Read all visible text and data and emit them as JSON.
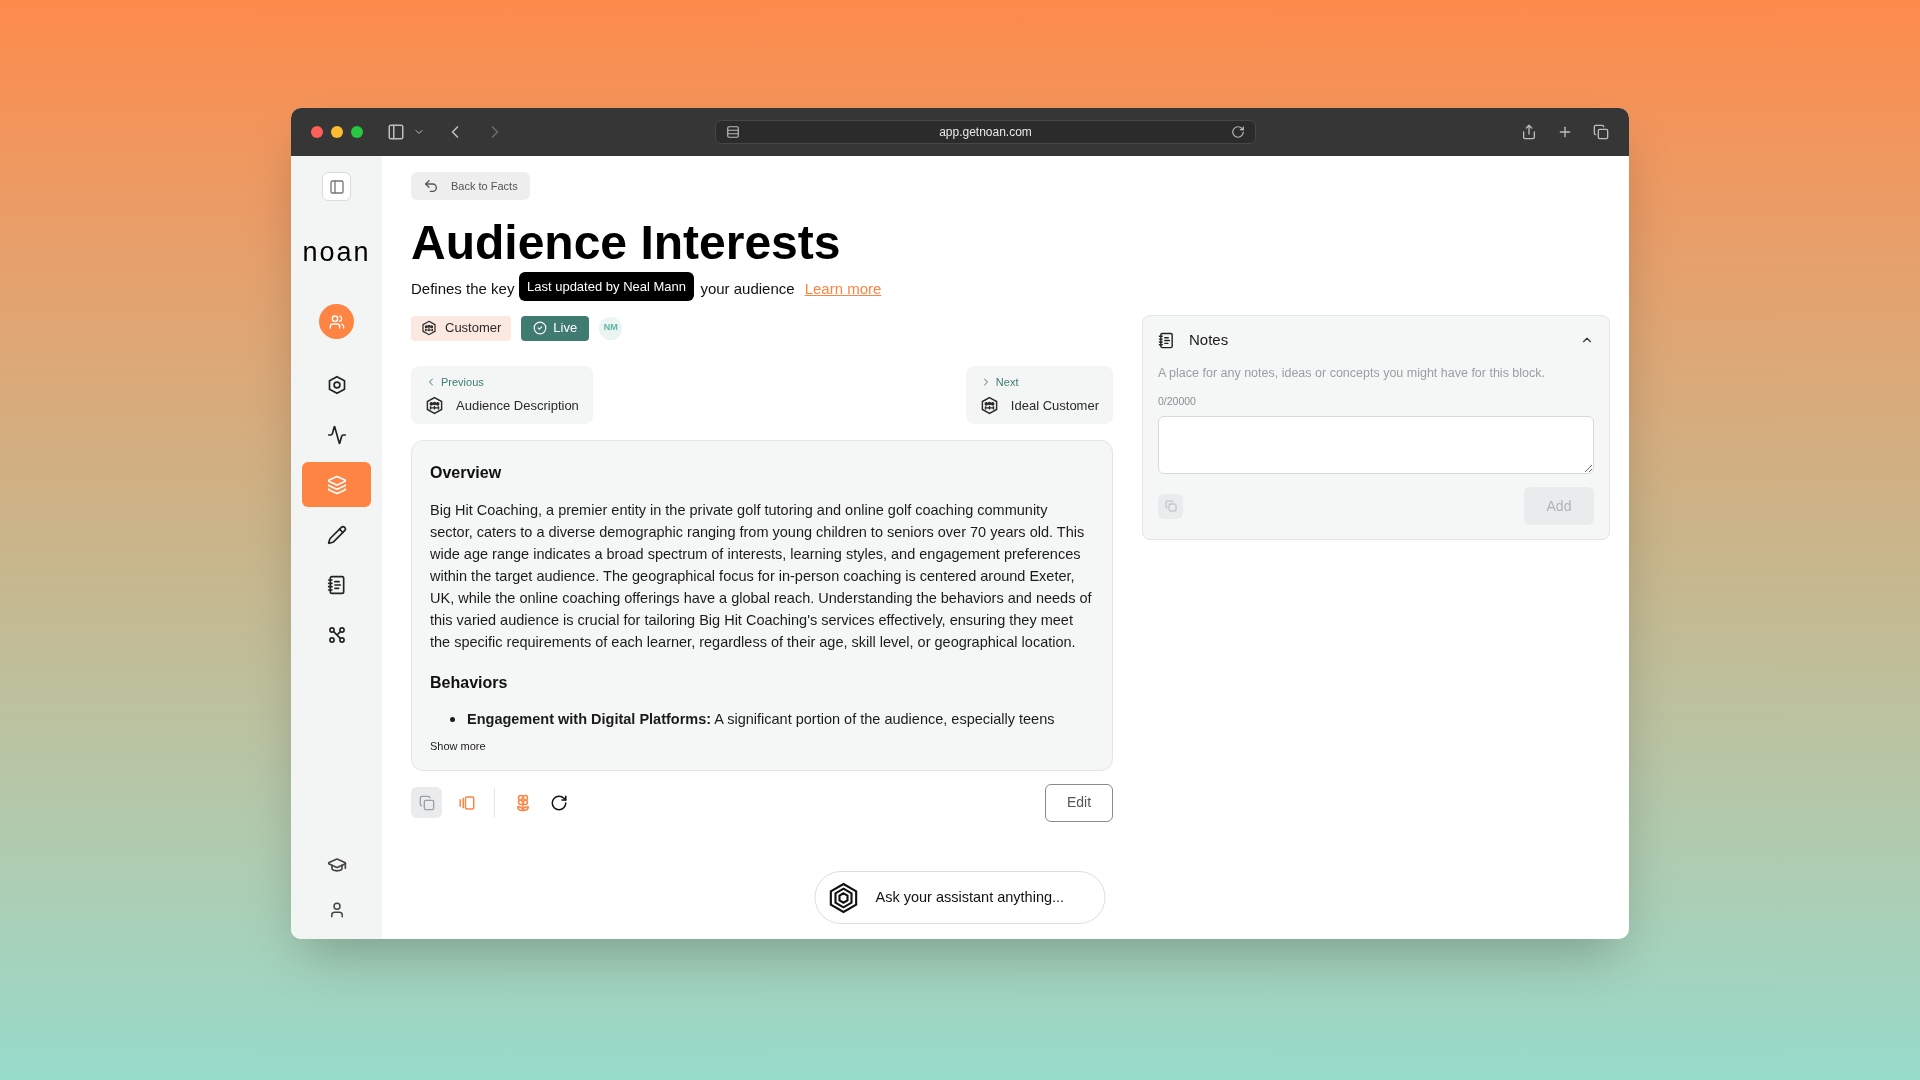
{
  "browser": {
    "url": "app.getnoan.com"
  },
  "sidebar": {
    "logo": "noan",
    "nav": [
      {
        "selected": false
      },
      {
        "selected": false
      },
      {
        "selected": true
      },
      {
        "selected": false
      },
      {
        "selected": false
      },
      {
        "selected": false
      }
    ]
  },
  "back_button": "Back to Facts",
  "title": "Audience Interests",
  "description": {
    "before": "Defines the key",
    "after": "your audience",
    "link": "Learn more"
  },
  "tooltip": "Last updated by Neal Mann",
  "tags": [
    {
      "label": "Customer",
      "kind": "category"
    },
    {
      "label": "Live",
      "kind": "status"
    }
  ],
  "avatar_initials": "NM",
  "previous": {
    "label": "Previous",
    "title": "Audience Description"
  },
  "next": {
    "label": "Next",
    "title": "Ideal Customer"
  },
  "overview": {
    "sections": [
      {
        "heading": "Overview",
        "paragraph": "Big Hit Coaching, a premier entity in the private golf tutoring and online golf coaching community sector, caters to a diverse demographic ranging from young children to seniors over 70 years old. This wide age range indicates a broad spectrum of interests, learning styles, and engagement preferences within the target audience. The geographical focus for in-person coaching is centered around Exeter, UK, while the online coaching offerings have a global reach. Understanding the behaviors and needs of this varied audience is crucial for tailoring Big Hit Coaching's services effectively, ensuring they meet the specific requirements of each learner, regardless of their age, skill level, or geographical location."
      },
      {
        "heading": "Behaviors",
        "bullets": [
          "**Engagement with Digital Platforms:** A significant portion of the audience, especially teens"
        ]
      }
    ],
    "show_more": "Show more"
  },
  "edit_button": "Edit",
  "assistant": {
    "label": "Ask your assistant anything..."
  },
  "notes": {
    "title": "Notes",
    "expanded": true,
    "description": "A place for any notes, ideas or concepts you might have for this block.",
    "counter": "0/20000",
    "add_button": {
      "label": "Add",
      "disabled": true
    }
  }
}
